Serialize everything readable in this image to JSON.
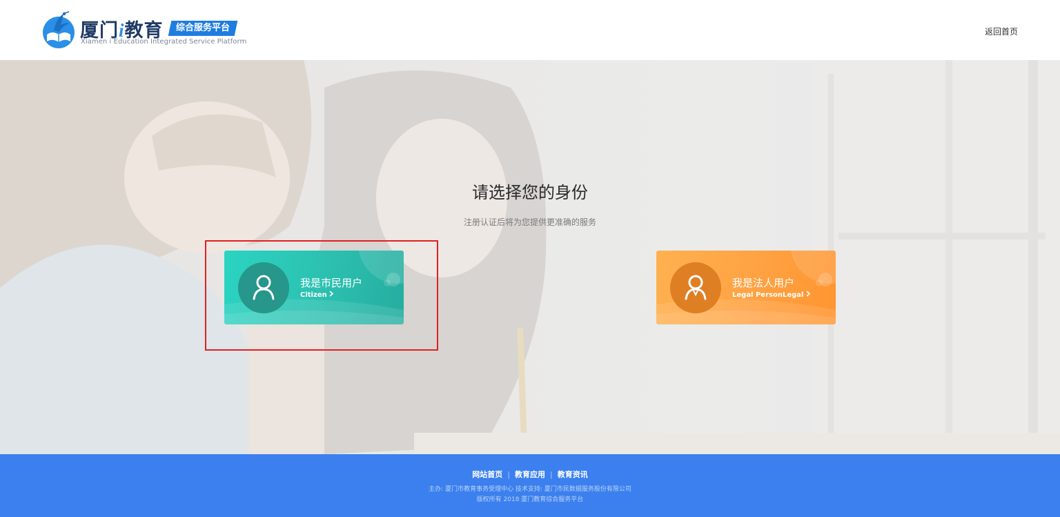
{
  "header": {
    "logo": {
      "cn_prefix": "厦门",
      "cn_i": "i",
      "cn_suffix": "教育",
      "badge": "综合服务平台",
      "en": "Xiamen i Education Integrated Service Platform",
      "icon": "book-crane-logo-icon"
    },
    "back_home": "返回首页"
  },
  "hero": {
    "title": "请选择您的身份",
    "subtitle": "注册认证后将为您提供更准确的服务"
  },
  "cards": {
    "citizen": {
      "label": "我是市民用户",
      "label_en": "Citizen",
      "icon": "user-icon",
      "color": "#2cc0b0"
    },
    "legal": {
      "label": "我是法人用户",
      "label_en": "Legal PersonLegal",
      "icon": "user-icon",
      "color": "#ffa243"
    },
    "chevron_icon": "chevron-right-icon"
  },
  "highlight_color": "#e02020",
  "footer": {
    "links": [
      "网站首页",
      "教育应用",
      "教育资讯"
    ],
    "line1": "主办: 厦门市教育事务受理中心 技术支持: 厦门市民数据服务股份有限公司",
    "line2": "版权所有 2018 厦门教育综合服务平台",
    "color": "#3b80ee"
  }
}
